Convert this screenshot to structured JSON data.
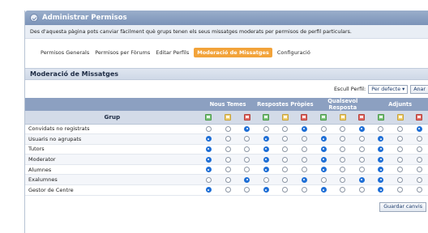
{
  "panel": {
    "title": "Administrar Permisos",
    "description": "Des d'aquesta pàgina pots canviar fàcilment què grups tenen els seus missatges moderats per permisos de perfil particulars."
  },
  "tabs": [
    {
      "label": "Permisos Generals",
      "active": false
    },
    {
      "label": "Permisos per Fòrums",
      "active": false
    },
    {
      "label": "Editar Perfils",
      "active": false
    },
    {
      "label": "Moderació de Missatges",
      "active": true
    },
    {
      "label": "Configuració",
      "active": false
    }
  ],
  "section": {
    "title": "Moderació de Missatges"
  },
  "profile": {
    "label": "Escull Perfil:",
    "selected": "Per defecte",
    "go_label": "Anar"
  },
  "table": {
    "group_header": "Grup",
    "column_groups": [
      "Nous Temes",
      "Respostes Pròpies",
      "Qualsevol Resposta",
      "Adjunts"
    ],
    "icon_columns": [
      "green-icon",
      "yellow-icon",
      "red-icon",
      "green-icon",
      "yellow-icon",
      "red-icon",
      "green-icon",
      "yellow-icon",
      "red-icon",
      "green-icon",
      "yellow-icon",
      "red-icon"
    ],
    "rows": [
      {
        "name": "Convidats no registrats",
        "choice": [
          2,
          2,
          2,
          2
        ]
      },
      {
        "name": "Usuaris no agrupats",
        "choice": [
          0,
          0,
          0,
          0
        ]
      },
      {
        "name": "Tutors",
        "choice": [
          0,
          0,
          0,
          0
        ]
      },
      {
        "name": "Moderator",
        "choice": [
          0,
          0,
          0,
          0
        ]
      },
      {
        "name": "Alumnes",
        "choice": [
          0,
          0,
          0,
          0
        ]
      },
      {
        "name": "Exalumnes",
        "choice": [
          2,
          2,
          2,
          0
        ]
      },
      {
        "name": "Gestor de Centre",
        "choice": [
          0,
          0,
          0,
          0
        ]
      }
    ]
  },
  "footer": {
    "save_label": "Guardar canvis"
  }
}
